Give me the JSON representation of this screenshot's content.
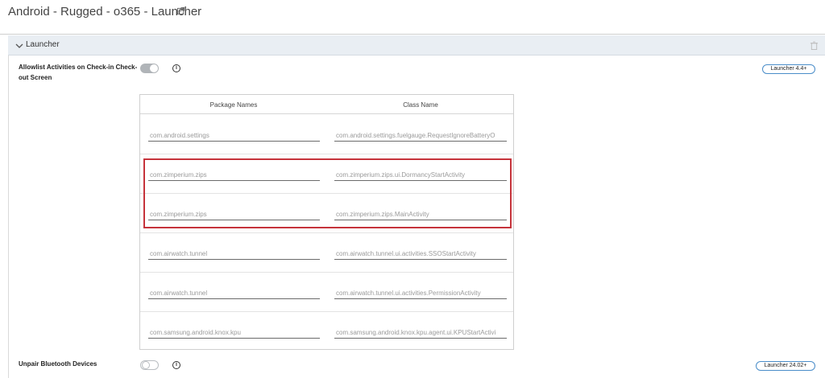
{
  "header": {
    "title": "Android - Rugged - o365 - Launcher",
    "external_link_icon": "external-link-icon"
  },
  "section": {
    "title": "Launcher",
    "expanded": true,
    "chevron_icon": "chevron-down-icon",
    "delete_icon": "trash-icon"
  },
  "allowlist": {
    "label": "Allowlist Activities on Check-in Check-out Screen",
    "toggle_on": true,
    "info_icon": "i",
    "badge": "Launcher 4.4+",
    "table": {
      "columns": [
        "Package Names",
        "Class Name"
      ],
      "rows": [
        {
          "package": "com.android.settings",
          "class": "com.android.settings.fuelgauge.RequestIgnoreBatteryO"
        },
        {
          "package": "com.zimperium.zips",
          "class": "com.zimperium.zips.ui.DormancyStartActivity"
        },
        {
          "package": "com.zimperium.zips",
          "class": "com.zimperium.zips.MainActivity"
        },
        {
          "package": "com.airwatch.tunnel",
          "class": "com.airwatch.tunnel.ui.activities.SSOStartActivity"
        },
        {
          "package": "com.airwatch.tunnel",
          "class": "com.airwatch.tunnel.ui.activities.PermissionActivity"
        },
        {
          "package": "com.samsung.android.knox.kpu",
          "class": "com.samsung.android.knox.kpu.agent.ui.KPUStartActivi"
        }
      ]
    }
  },
  "bluetooth": {
    "label": "Unpair Bluetooth Devices",
    "toggle_on": false,
    "info_icon": "i",
    "badge": "Launcher 24.02+"
  },
  "colors": {
    "highlight": "#c6333b",
    "badge_border": "#4a8dc9",
    "section_bg": "#e9eef3"
  }
}
